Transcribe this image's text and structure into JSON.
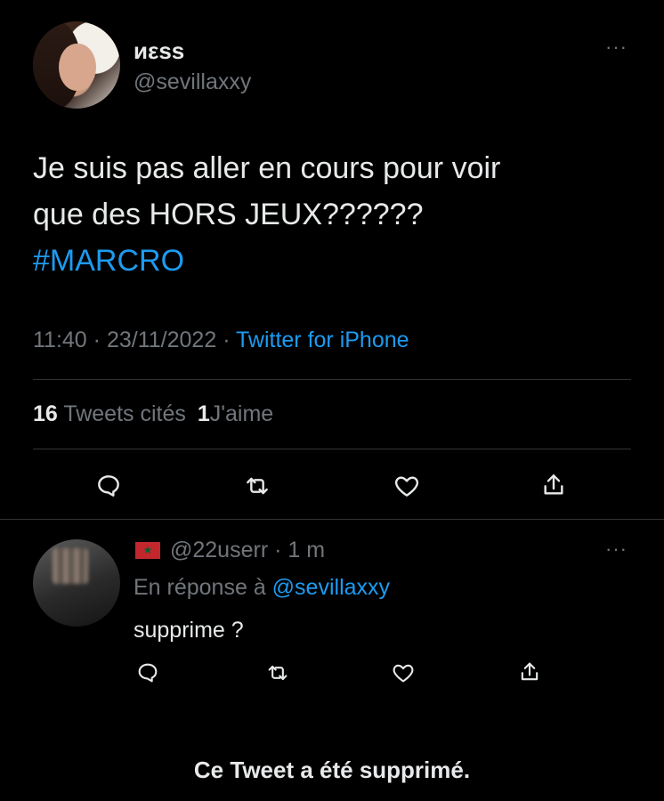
{
  "tweet": {
    "display_name": "иεss",
    "handle": "@sevillaxxy",
    "text_line1": "Je suis pas aller en cours pour voir",
    "text_line2": "que des HORS JEUX??????",
    "hashtag": "#MARCRO",
    "time": "11:40",
    "sep1": "·",
    "date": "23/11/2022",
    "sep2": "·",
    "source": "Twitter for iPhone",
    "quote_count": "16",
    "quote_label": "Tweets cités",
    "like_count": "1",
    "like_label": "J'aime",
    "more": "···"
  },
  "reply": {
    "flag_emoji": "★",
    "handle": "@22userr",
    "sep": "·",
    "age": "1 m",
    "in_reply_prefix": "En réponse à",
    "in_reply_handle": "@sevillaxxy",
    "text": "supprime ?",
    "more": "···"
  },
  "footer": {
    "deleted_message": "Ce Tweet a été supprimé."
  },
  "colors": {
    "background": "#000000",
    "text": "#e7e9ea",
    "muted": "#71767b",
    "accent": "#1d9bf0",
    "divider": "#2f3336"
  },
  "icons": [
    "reply-icon",
    "retweet-icon",
    "like-icon",
    "share-icon",
    "more-icon"
  ]
}
